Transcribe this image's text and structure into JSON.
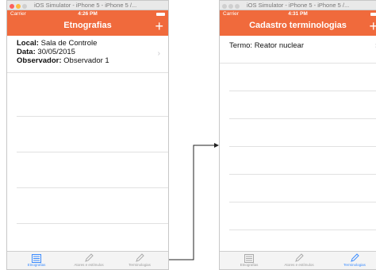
{
  "left": {
    "window_title": "iOS Simulator - iPhone 5 - iPhone 5 /...",
    "carrier": "Carrier",
    "time": "4:26 PM",
    "nav_title": "Etnografias",
    "add": "+",
    "record": {
      "local_label": "Local:",
      "local_value": "Sala de Controle",
      "data_label": "Data:",
      "data_value": "30/05/2015",
      "observador_label": "Observador:",
      "observador_value": "Observador 1"
    },
    "tabs": [
      "Etnografias",
      "Atores e estímulos",
      "Terminologias"
    ],
    "active_tab": 0
  },
  "right": {
    "window_title": "iOS Simulator - iPhone 5 - iPhone 5 /...",
    "carrier": "Carrier",
    "time": "4:31 PM",
    "nav_title": "Cadastro terminologias",
    "add": "+",
    "record": {
      "termo_label": "Termo:",
      "termo_value": "Reator nuclear"
    },
    "tabs": [
      "Etnografias",
      "Atores e estímulos",
      "Terminologias"
    ],
    "active_tab": 2
  },
  "colors": {
    "accent": "#f06a3c",
    "tab_active": "#3b8cff",
    "tab_inactive": "#9a9a9a"
  },
  "icons": {
    "tab0": "list-icon",
    "tab1": "pencil-icon",
    "tab2": "pencil-icon",
    "chevron": "chevron-right-icon"
  }
}
